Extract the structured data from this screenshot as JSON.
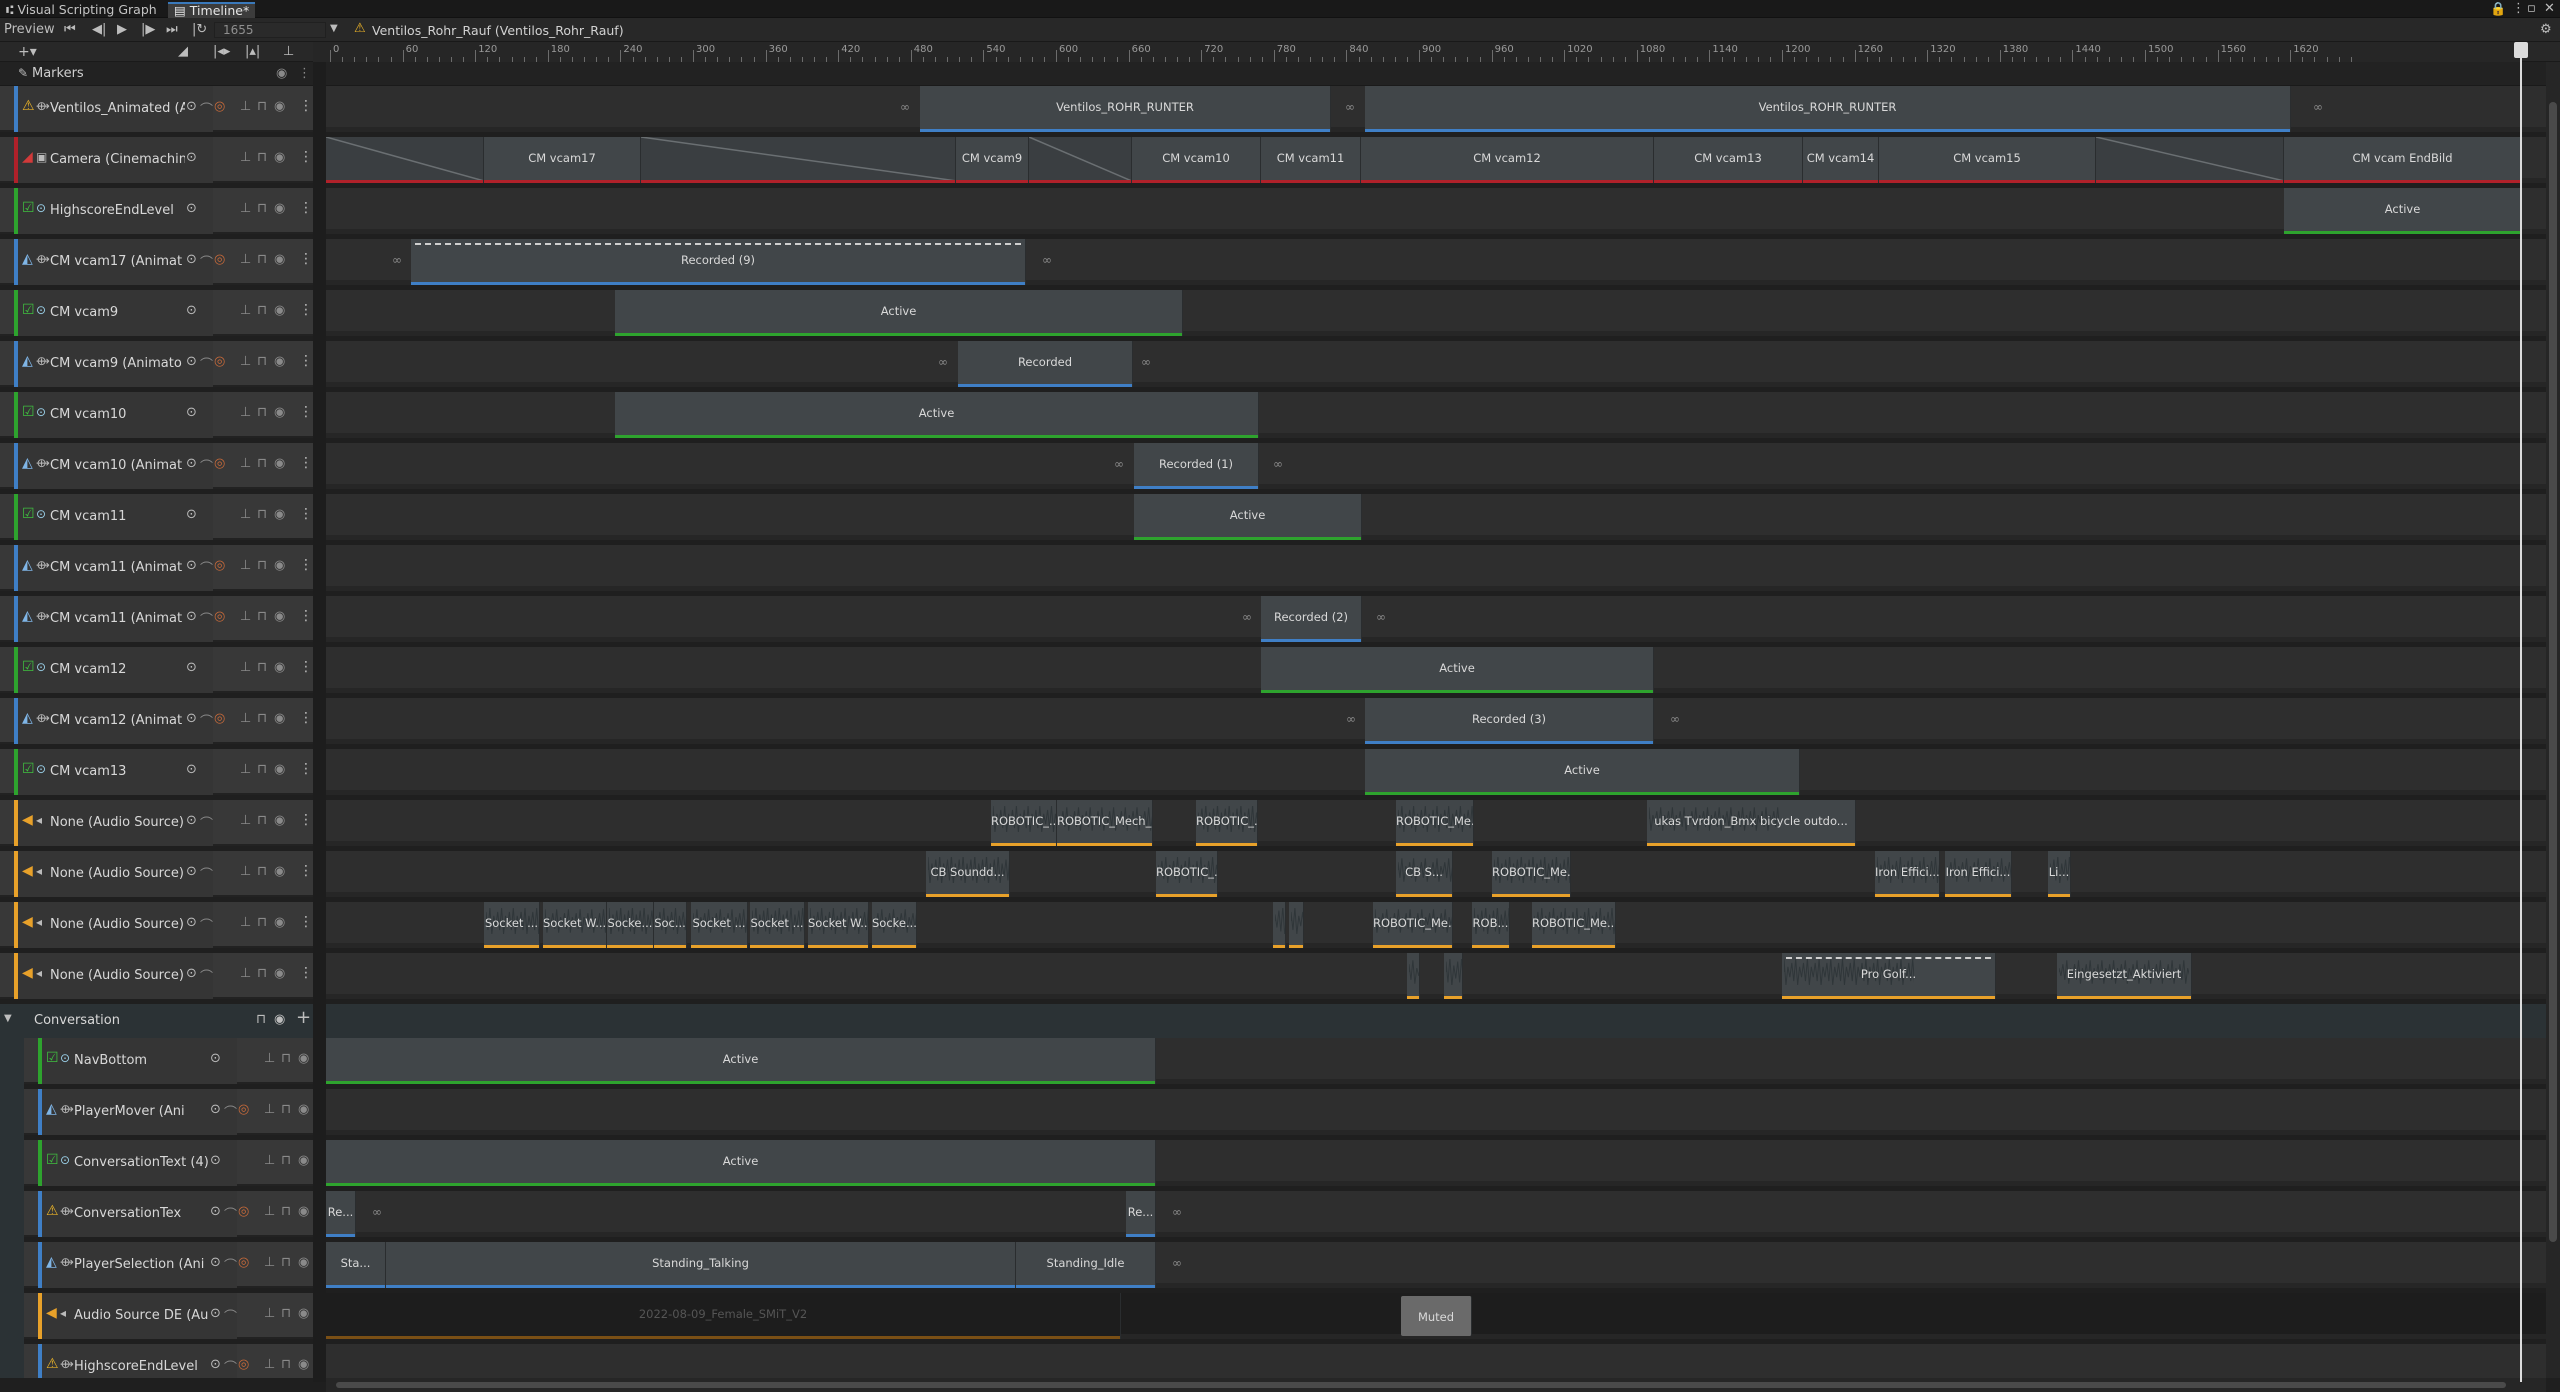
{
  "tabs": [
    {
      "label": "Visual Scripting Graph"
    },
    {
      "label": "Timeline*"
    }
  ],
  "toolbar": {
    "preview_label": "Preview",
    "frame": "1655",
    "asset_title": "Ventilos_Rohr_Rauf (Ventilos_Rohr_Rauf)"
  },
  "markers_label": "Markers",
  "ruler_labels": [
    "0",
    "60",
    "120",
    "180",
    "240",
    "300",
    "360",
    "420",
    "480",
    "540",
    "600",
    "660",
    "720",
    "780",
    "840",
    "900",
    "960",
    "1020",
    "1080",
    "1140",
    "1200",
    "1260",
    "1320",
    "1380",
    "1440",
    "1500",
    "1560",
    "1620"
  ],
  "tracks": [
    {
      "name": "Ventilos_Animated (Anim",
      "type": "anim",
      "warn": true
    },
    {
      "name": "Camera (Cinemachine Brain",
      "type": "cine"
    },
    {
      "name": "HighscoreEndLevel",
      "type": "active"
    },
    {
      "name": "CM vcam17 (Animat",
      "type": "anim"
    },
    {
      "name": "CM vcam9",
      "type": "active"
    },
    {
      "name": "CM vcam9 (Animato",
      "type": "anim"
    },
    {
      "name": "CM vcam10",
      "type": "active"
    },
    {
      "name": "CM vcam10 (Animat",
      "type": "anim"
    },
    {
      "name": "CM vcam11",
      "type": "active"
    },
    {
      "name": "CM vcam11 (Animat",
      "type": "anim"
    },
    {
      "name": "CM vcam11 (Animat",
      "type": "anim"
    },
    {
      "name": "CM vcam12",
      "type": "active"
    },
    {
      "name": "CM vcam12 (Animat",
      "type": "anim"
    },
    {
      "name": "CM vcam13",
      "type": "active"
    },
    {
      "name": "None (Audio Source)",
      "type": "audio"
    },
    {
      "name": "None (Audio Source)",
      "type": "audio"
    },
    {
      "name": "None (Audio Source)",
      "type": "audio"
    },
    {
      "name": "None (Audio Source)",
      "type": "audio"
    }
  ],
  "group": {
    "name": "Conversation"
  },
  "group_tracks": [
    {
      "name": "NavBottom",
      "type": "active"
    },
    {
      "name": "PlayerMover (Ani",
      "type": "anim"
    },
    {
      "name": "ConversationText (4)",
      "type": "active"
    },
    {
      "name": "ConversationTex",
      "type": "anim",
      "warn": true
    },
    {
      "name": "PlayerSelection (Ani",
      "type": "anim"
    },
    {
      "name": "Audio Source DE (Au",
      "type": "audio"
    },
    {
      "name": "HighscoreEndLevel",
      "type": "anim",
      "warn": true
    }
  ],
  "clips": [
    {
      "lane": 0,
      "start": 594,
      "end": 1005,
      "label": "Ventilos_ROHR_RUNTER",
      "kind": "anim"
    },
    {
      "lane": 0,
      "start": 1039,
      "end": 1965,
      "label": "Ventilos_ROHR_RUNTER",
      "kind": "anim"
    },
    {
      "lane": 1,
      "start": 0,
      "end": 158,
      "label": "",
      "kind": "cine",
      "blend": "up"
    },
    {
      "lane": 1,
      "start": 158,
      "end": 315,
      "label": "CM vcam17",
      "kind": "cine"
    },
    {
      "lane": 1,
      "start": 315,
      "end": 630,
      "label": "",
      "kind": "cine",
      "blend": "down"
    },
    {
      "lane": 1,
      "start": 630,
      "end": 703,
      "label": "CM vcam9",
      "kind": "cine"
    },
    {
      "lane": 1,
      "start": 703,
      "end": 806,
      "label": "",
      "kind": "cine",
      "blend": "down"
    },
    {
      "lane": 1,
      "start": 806,
      "end": 935,
      "label": "CM vcam10",
      "kind": "cine"
    },
    {
      "lane": 1,
      "start": 935,
      "end": 1035,
      "label": "CM vcam11",
      "kind": "cine"
    },
    {
      "lane": 1,
      "start": 1035,
      "end": 1328,
      "label": "CM vcam12",
      "kind": "cine"
    },
    {
      "lane": 1,
      "start": 1328,
      "end": 1477,
      "label": "CM vcam13",
      "kind": "cine"
    },
    {
      "lane": 1,
      "start": 1477,
      "end": 1553,
      "label": "CM vcam14",
      "kind": "cine"
    },
    {
      "lane": 1,
      "start": 1553,
      "end": 1770,
      "label": "CM vcam15",
      "kind": "cine"
    },
    {
      "lane": 1,
      "start": 1770,
      "end": 1958,
      "label": "",
      "kind": "cine",
      "blend": "down"
    },
    {
      "lane": 1,
      "start": 1958,
      "end": 2196,
      "label": "CM vcam EndBild",
      "kind": "cine"
    },
    {
      "lane": 2,
      "start": 1958,
      "end": 2196,
      "label": "Active",
      "kind": "active"
    },
    {
      "lane": 3,
      "start": 85,
      "end": 700,
      "label": "Recorded (9)",
      "kind": "anim",
      "dashed": true
    },
    {
      "lane": 4,
      "start": 289,
      "end": 857,
      "label": "Active",
      "kind": "active"
    },
    {
      "lane": 5,
      "start": 632,
      "end": 807,
      "label": "Recorded",
      "kind": "anim"
    },
    {
      "lane": 6,
      "start": 289,
      "end": 933,
      "label": "Active",
      "kind": "active"
    },
    {
      "lane": 7,
      "start": 808,
      "end": 933,
      "label": "Recorded (1)",
      "kind": "anim"
    },
    {
      "lane": 8,
      "start": 808,
      "end": 1036,
      "label": "Active",
      "kind": "active"
    },
    {
      "lane": 10,
      "start": 935,
      "end": 1036,
      "label": "Recorded (2)",
      "kind": "anim"
    },
    {
      "lane": 11,
      "start": 935,
      "end": 1328,
      "label": "Active",
      "kind": "active"
    },
    {
      "lane": 12,
      "start": 1039,
      "end": 1328,
      "label": "Recorded (3)",
      "kind": "anim"
    },
    {
      "lane": 13,
      "start": 1039,
      "end": 1474,
      "label": "Active",
      "kind": "active"
    },
    {
      "lane": 14,
      "start": 665,
      "end": 731,
      "label": "ROBOTIC_...",
      "kind": "audio"
    },
    {
      "lane": 14,
      "start": 731,
      "end": 827,
      "label": "ROBOTIC_Mech_...",
      "kind": "audio"
    },
    {
      "lane": 14,
      "start": 870,
      "end": 932,
      "label": "ROBOTIC_...",
      "kind": "audio"
    },
    {
      "lane": 14,
      "start": 1070,
      "end": 1148,
      "label": "ROBOTIC_Me...",
      "kind": "audio"
    },
    {
      "lane": 14,
      "start": 1321,
      "end": 1530,
      "label": "ukas Tvrdon_Bmx bicycle outdo...",
      "kind": "audio"
    },
    {
      "lane": 15,
      "start": 600,
      "end": 684,
      "label": "CB Soundd...",
      "kind": "audio"
    },
    {
      "lane": 15,
      "start": 830,
      "end": 892,
      "label": "ROBOTIC_...",
      "kind": "audio"
    },
    {
      "lane": 15,
      "start": 1070,
      "end": 1127,
      "label": "CB S...",
      "kind": "audio"
    },
    {
      "lane": 15,
      "start": 1166,
      "end": 1245,
      "label": "ROBOTIC_Me...",
      "kind": "audio"
    },
    {
      "lane": 15,
      "start": 1549,
      "end": 1614,
      "label": "Iron Effici...",
      "kind": "audio"
    },
    {
      "lane": 15,
      "start": 1619,
      "end": 1686,
      "label": "Iron Effici...",
      "kind": "audio"
    },
    {
      "lane": 15,
      "start": 1722,
      "end": 1745,
      "label": "Li...",
      "kind": "audio"
    },
    {
      "lane": 16,
      "start": 158,
      "end": 214,
      "label": "Socket ...",
      "kind": "audio"
    },
    {
      "lane": 16,
      "start": 217,
      "end": 281,
      "label": "Socket W...",
      "kind": "audio"
    },
    {
      "lane": 16,
      "start": 281,
      "end": 328,
      "label": "Socke...",
      "kind": "audio"
    },
    {
      "lane": 16,
      "start": 328,
      "end": 361,
      "label": "Soc...",
      "kind": "audio"
    },
    {
      "lane": 16,
      "start": 365,
      "end": 422,
      "label": "Socket ...",
      "kind": "audio"
    },
    {
      "lane": 16,
      "start": 424,
      "end": 479,
      "label": "Socket ...",
      "kind": "audio"
    },
    {
      "lane": 16,
      "start": 482,
      "end": 543,
      "label": "Socket W...",
      "kind": "audio"
    },
    {
      "lane": 16,
      "start": 546,
      "end": 591,
      "label": "Socke...",
      "kind": "audio"
    },
    {
      "lane": 16,
      "start": 947,
      "end": 960,
      "label": "",
      "kind": "audio"
    },
    {
      "lane": 16,
      "start": 963,
      "end": 978,
      "label": "",
      "kind": "audio"
    },
    {
      "lane": 16,
      "start": 1047,
      "end": 1127,
      "label": "ROBOTIC_Me...",
      "kind": "audio"
    },
    {
      "lane": 16,
      "start": 1146,
      "end": 1184,
      "label": "ROB...",
      "kind": "audio"
    },
    {
      "lane": 16,
      "start": 1206,
      "end": 1290,
      "label": "ROBOTIC_Me...",
      "kind": "audio"
    },
    {
      "lane": 17,
      "start": 1081,
      "end": 1094,
      "label": "",
      "kind": "audio"
    },
    {
      "lane": 17,
      "start": 1118,
      "end": 1137,
      "label": "",
      "kind": "audio"
    },
    {
      "lane": 17,
      "start": 1456,
      "end": 1670,
      "label": "Pro Golf...",
      "kind": "audio",
      "dashed": true
    },
    {
      "lane": 17,
      "start": 1731,
      "end": 1866,
      "label": "Eingesetzt_Aktiviert",
      "kind": "audio"
    },
    {
      "lane": 18,
      "start": 0,
      "end": 830,
      "label": "Active",
      "kind": "active"
    },
    {
      "lane": 20,
      "start": 0,
      "end": 830,
      "label": "Active",
      "kind": "active"
    },
    {
      "lane": 21,
      "start": 0,
      "end": 30,
      "label": "Re...",
      "kind": "anim"
    },
    {
      "lane": 21,
      "start": 800,
      "end": 830,
      "label": "Re...",
      "kind": "anim"
    },
    {
      "lane": 22,
      "start": 0,
      "end": 60,
      "label": "Sta...",
      "kind": "anim"
    },
    {
      "lane": 22,
      "start": 60,
      "end": 690,
      "label": "Standing_Talking",
      "kind": "anim"
    },
    {
      "lane": 22,
      "start": 690,
      "end": 830,
      "label": "Standing_Idle",
      "kind": "anim"
    },
    {
      "lane": 23,
      "start": 0,
      "end": 795,
      "label": "2022-08-09_Female_SMiT_V2",
      "kind": "muted"
    },
    {
      "lane": 23,
      "start": 1075,
      "end": 1146,
      "label": "Muted",
      "kind": "mutedtag"
    }
  ],
  "colors": {
    "anim": "#3f7fc6",
    "active": "#2ea32e",
    "cine": "#b0212a",
    "audio": "#e8a12a",
    "warn": "#e8b128"
  }
}
